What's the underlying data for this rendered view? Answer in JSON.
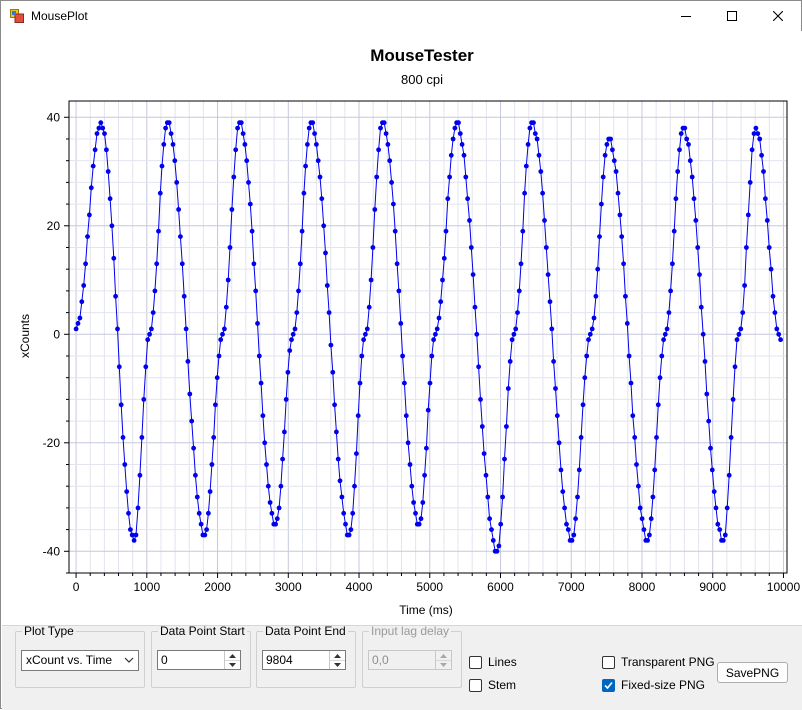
{
  "window": {
    "title": "MousePlot",
    "controls": {
      "minimize_icon": "minimize-icon",
      "maximize_icon": "maximize-icon",
      "close_icon": "close-icon"
    }
  },
  "chart_data": {
    "type": "scatter",
    "title": "MouseTester",
    "subtitle": "800 cpi",
    "xlabel": "Time (ms)",
    "ylabel": "xCounts",
    "xlim": [
      -100,
      10050
    ],
    "ylim": [
      -44,
      43
    ],
    "xticks": [
      0,
      1000,
      2000,
      3000,
      4000,
      5000,
      6000,
      7000,
      8000,
      9000,
      10000
    ],
    "yticks": [
      -40,
      -20,
      0,
      20,
      40
    ],
    "grid": true,
    "color": "#0000ee",
    "series": [
      {
        "style": "line+markers",
        "periods": [
          {
            "start": 0,
            "peak_t": 350,
            "peak": 39,
            "trough_t": 820,
            "trough": -38
          },
          {
            "start": 1040,
            "peak_t": 1290,
            "peak": 39,
            "trough_t": 1820,
            "trough": -37
          },
          {
            "start": 2070,
            "peak_t": 2310,
            "peak": 39,
            "trough_t": 2820,
            "trough": -35
          },
          {
            "start": 3070,
            "peak_t": 3320,
            "peak": 39,
            "trough_t": 3860,
            "trough": -37
          },
          {
            "start": 4090,
            "peak_t": 4330,
            "peak": 39,
            "trough_t": 4850,
            "trough": -35
          },
          {
            "start": 5080,
            "peak_t": 5380,
            "peak": 39,
            "trough_t": 5950,
            "trough": -40
          },
          {
            "start": 6190,
            "peak_t": 6440,
            "peak": 39,
            "trough_t": 7010,
            "trough": -38
          },
          {
            "start": 7270,
            "peak_t": 7530,
            "peak": 36,
            "trough_t": 8080,
            "trough": -38
          },
          {
            "start": 8330,
            "peak_t": 8580,
            "peak": 38,
            "trough_t": 9150,
            "trough": -38
          },
          {
            "start": 9370,
            "peak_t": 9610,
            "peak": 38,
            "trough_t": null,
            "trough": null
          }
        ],
        "end_t": 9960,
        "end_value": -1
      }
    ]
  },
  "controls": {
    "plot_type": {
      "legend": "Plot Type",
      "selected": "xCount vs. Time",
      "arrow_icon": "chevron-down-icon"
    },
    "data_point_start": {
      "legend": "Data Point Start",
      "value": "0"
    },
    "data_point_end": {
      "legend": "Data Point End",
      "value": "9804"
    },
    "input_lag_delay": {
      "legend": "Input lag delay",
      "value": "0,0"
    },
    "lines": {
      "label": "Lines",
      "checked": false
    },
    "stem": {
      "label": "Stem",
      "checked": false
    },
    "transparent_png": {
      "label": "Transparent PNG",
      "checked": false
    },
    "fixed_size_png": {
      "label": "Fixed-size PNG",
      "checked": true
    },
    "save_png_label": "SavePNG"
  }
}
